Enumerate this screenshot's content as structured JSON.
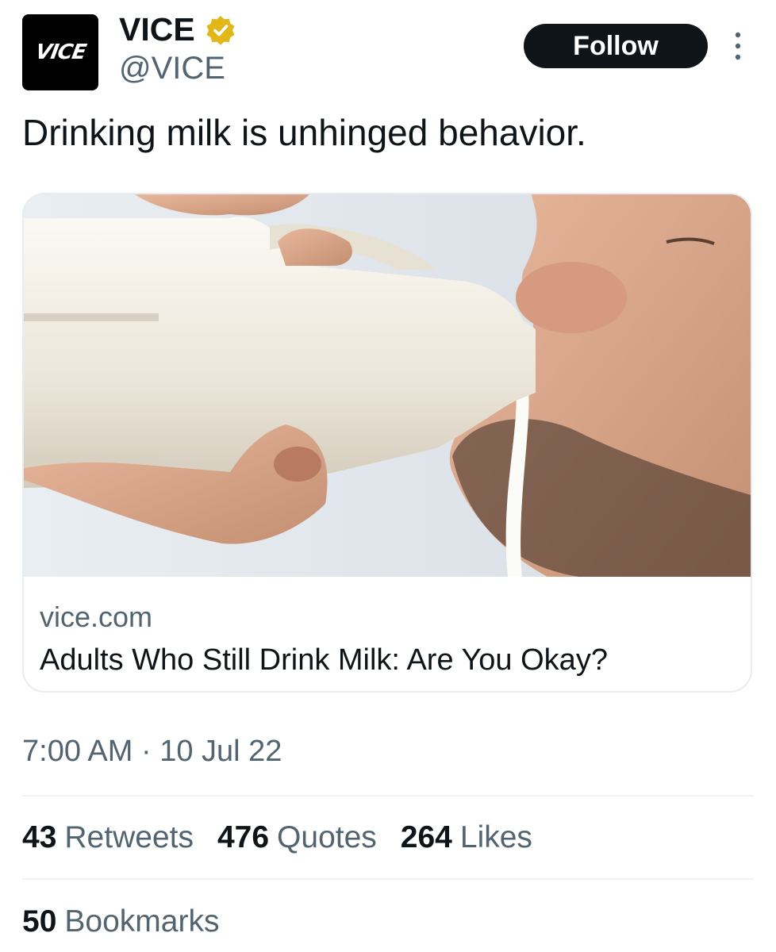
{
  "author": {
    "avatar_text": "VICE",
    "display_name": "VICE",
    "handle": "@VICE",
    "verified_badge": "verified-gold-icon"
  },
  "follow_label": "Follow",
  "more_menu": "more-vertical-icon",
  "tweet_text": "Drinking milk is unhinged behavior.",
  "card": {
    "image": "man drinking from a white plastic milk jug",
    "domain": "vice.com",
    "title": "Adults Who Still Drink Milk: Are You Okay?"
  },
  "timestamp": "7:00 AM · 10 Jul 22",
  "stats": {
    "retweets_count": "43",
    "retweets_label": "Retweets",
    "quotes_count": "476",
    "quotes_label": "Quotes",
    "likes_count": "264",
    "likes_label": "Likes",
    "bookmarks_count": "50",
    "bookmarks_label": "Bookmarks"
  },
  "colors": {
    "text_primary": "#0f1419",
    "text_secondary": "#536471",
    "badge_gold": "#e2b719",
    "follow_bg": "#0f1419"
  }
}
